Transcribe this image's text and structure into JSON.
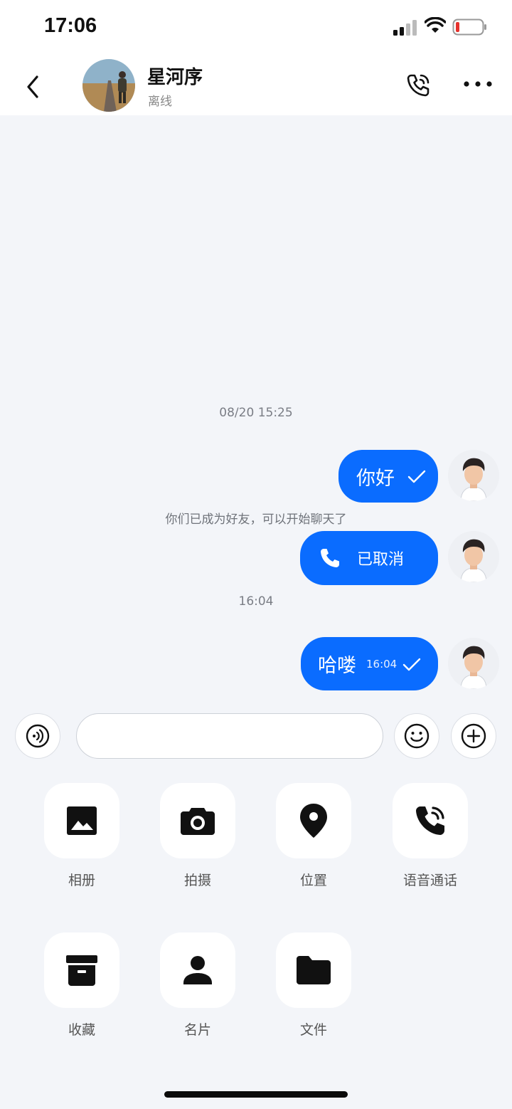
{
  "status_bar": {
    "time": "17:06"
  },
  "header": {
    "contact_name": "星河序",
    "contact_status": "离线"
  },
  "messages": [
    {
      "type": "timestamp",
      "text": "08/20 15:25"
    },
    {
      "type": "outgoing",
      "text": "你好",
      "read_icon": "check-icon"
    },
    {
      "type": "system",
      "text": "你们已成为好友，可以开始聊天了"
    },
    {
      "type": "outgoing-call",
      "text": "已取消",
      "icon": "phone-icon"
    },
    {
      "type": "timestamp",
      "text": "16:04"
    },
    {
      "type": "outgoing",
      "text": "哈喽",
      "time": "16:04",
      "read_icon": "check-icon"
    }
  ],
  "input": {
    "placeholder": ""
  },
  "tools": [
    {
      "label": "相册",
      "icon": "image-icon"
    },
    {
      "label": "拍摄",
      "icon": "camera-icon"
    },
    {
      "label": "位置",
      "icon": "location-pin-icon"
    },
    {
      "label": "语音通话",
      "icon": "phone-call-icon"
    },
    {
      "label": "收藏",
      "icon": "archive-box-icon"
    },
    {
      "label": "名片",
      "icon": "person-icon"
    },
    {
      "label": "文件",
      "icon": "folder-icon"
    }
  ],
  "colors": {
    "accent": "#0a6cff",
    "background": "#f3f5f9"
  }
}
